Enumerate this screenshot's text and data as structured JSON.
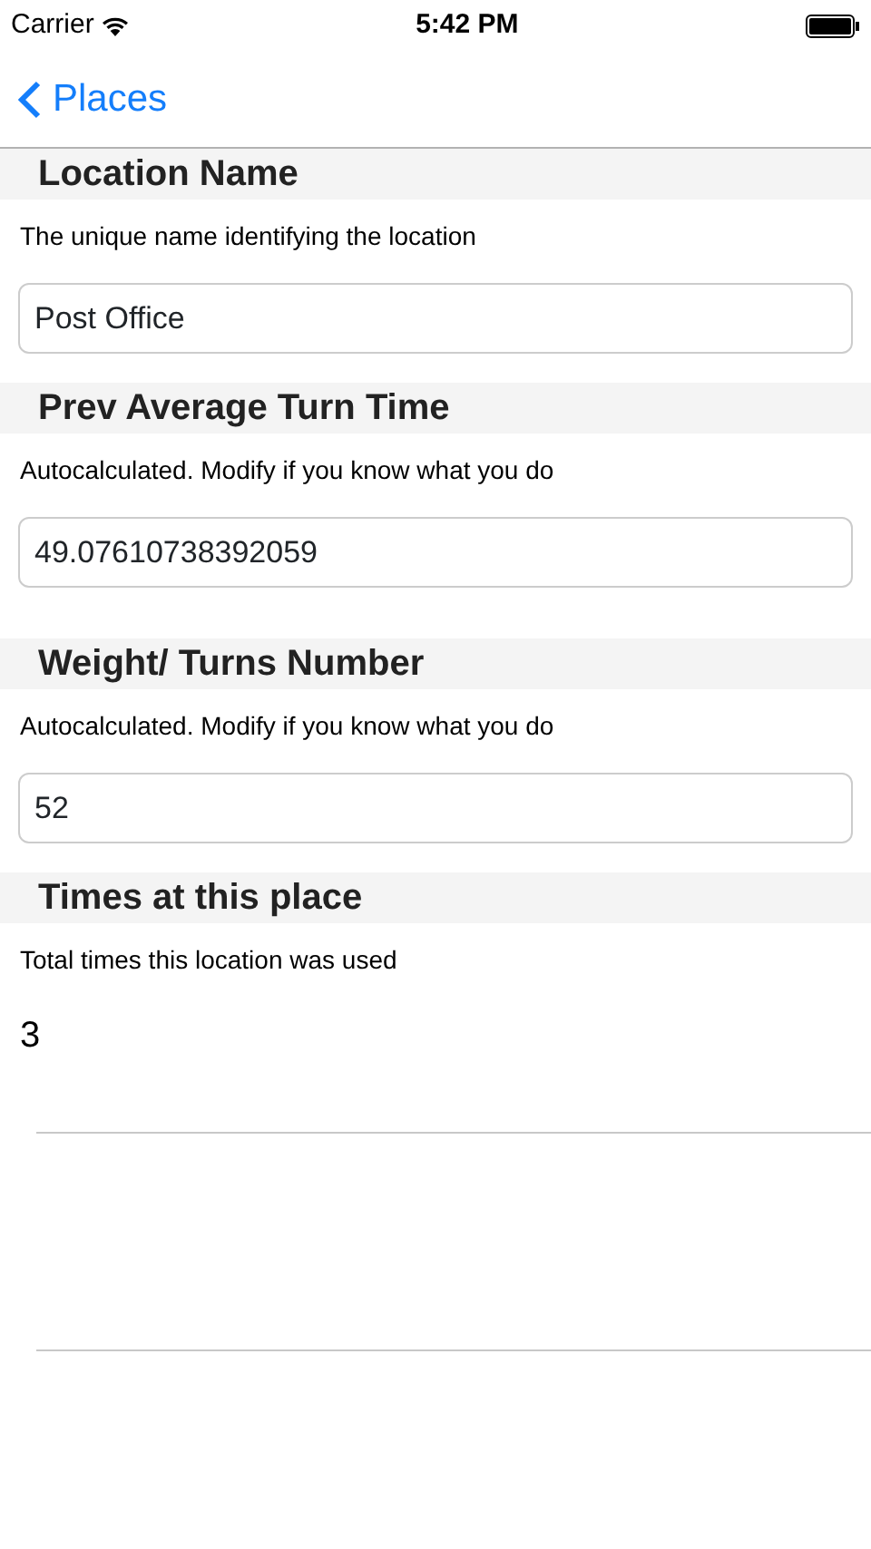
{
  "status_bar": {
    "carrier": "Carrier",
    "time": "5:42 PM"
  },
  "nav": {
    "back_label": "Places"
  },
  "sections": [
    {
      "kind": "field",
      "title": "Location Name",
      "description": "The unique name identifying the location",
      "value": "Post Office"
    },
    {
      "kind": "field",
      "title": "Prev Average Turn Time",
      "description": "Autocalculated. Modify if you know what you do",
      "value": "49.07610738392059"
    },
    {
      "kind": "field",
      "title": "Weight/ Turns Number",
      "description": "Autocalculated. Modify if you know what you do",
      "value": "52"
    },
    {
      "kind": "text",
      "title": "Times at this place",
      "description": "Total times this location was used",
      "value": "3"
    }
  ]
}
